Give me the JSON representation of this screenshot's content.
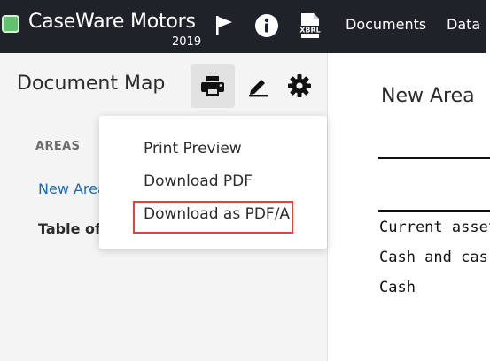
{
  "app": {
    "brand_name": "CaseWare Motors",
    "year": "2019",
    "brand_color": "#63c06f"
  },
  "topbar": {
    "icons": [
      "flag-icon",
      "info-icon",
      "xbrl-icon"
    ],
    "xbrl_label": "XBRL",
    "nav": {
      "documents": "Documents",
      "data": "Data"
    }
  },
  "left_panel": {
    "title": "Document Map",
    "tools": [
      "print-icon",
      "signature-icon",
      "gear-icon"
    ],
    "areas_label": "AREAS",
    "areas": [
      {
        "label": "New Area"
      },
      {
        "label": "Table of C"
      }
    ]
  },
  "dropdown": {
    "items": [
      {
        "label": "Print Preview"
      },
      {
        "label": "Download PDF"
      },
      {
        "label": "Download as PDF/A"
      }
    ],
    "highlight_color": "#e0443f"
  },
  "content": {
    "title": "New Area",
    "rows": [
      {
        "text": "Current asset"
      },
      {
        "text": "Cash and cas"
      },
      {
        "text": "Cash"
      }
    ]
  }
}
